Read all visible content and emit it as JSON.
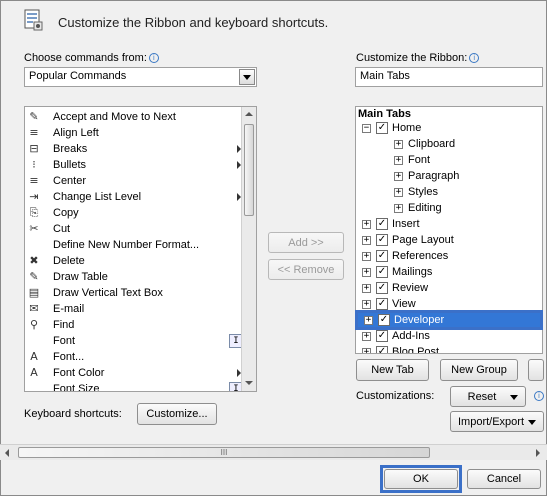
{
  "title": "Customize the Ribbon and keyboard shortcuts.",
  "left": {
    "label": "Choose commands from:",
    "info_glyph": "i",
    "combo_value": "Popular Commands",
    "commands": [
      {
        "label": "Accept and Move to Next",
        "icon": "✎",
        "arrow": false
      },
      {
        "label": "Align Left",
        "icon": "≡",
        "arrow": false
      },
      {
        "label": "Breaks",
        "icon": "⊟",
        "arrow": true
      },
      {
        "label": "Bullets",
        "icon": "⁝",
        "arrow": true
      },
      {
        "label": "Center",
        "icon": "≡",
        "arrow": false
      },
      {
        "label": "Change List Level",
        "icon": "⇥",
        "arrow": true
      },
      {
        "label": "Copy",
        "icon": "⎘",
        "arrow": false
      },
      {
        "label": "Cut",
        "icon": "✂",
        "arrow": false
      },
      {
        "label": "Define New Number Format...",
        "icon": "",
        "arrow": false
      },
      {
        "label": "Delete",
        "icon": "✖",
        "arrow": false
      },
      {
        "label": "Draw Table",
        "icon": "✎",
        "arrow": false
      },
      {
        "label": "Draw Vertical Text Box",
        "icon": "▤",
        "arrow": false
      },
      {
        "label": "E-mail",
        "icon": "✉",
        "arrow": false
      },
      {
        "label": "Find",
        "icon": "⚲",
        "arrow": false
      },
      {
        "label": "Font",
        "icon": "",
        "arrow": false,
        "side": "I"
      },
      {
        "label": "Font...",
        "icon": "A",
        "arrow": false
      },
      {
        "label": "Font Color",
        "icon": "A",
        "arrow": true
      },
      {
        "label": "Font Size",
        "icon": "",
        "arrow": false,
        "side": "I"
      }
    ],
    "keyboard_label": "Keyboard shortcuts:",
    "customize_button": "Customize..."
  },
  "middle": {
    "add_button": "Add >>",
    "remove_button": "<< Remove"
  },
  "right": {
    "label": "Customize the Ribbon:",
    "info_glyph": "i",
    "combo_value": "Main Tabs",
    "tree_header": "Main Tabs",
    "tree": [
      {
        "label": "Home",
        "expander": "−",
        "checked": true,
        "level": 0
      },
      {
        "label": "Clipboard",
        "expander": "+",
        "checked": null,
        "level": 1
      },
      {
        "label": "Font",
        "expander": "+",
        "checked": null,
        "level": 1
      },
      {
        "label": "Paragraph",
        "expander": "+",
        "checked": null,
        "level": 1
      },
      {
        "label": "Styles",
        "expander": "+",
        "checked": null,
        "level": 1
      },
      {
        "label": "Editing",
        "expander": "+",
        "checked": null,
        "level": 1
      },
      {
        "label": "Insert",
        "expander": "+",
        "checked": true,
        "level": 0
      },
      {
        "label": "Page Layout",
        "expander": "+",
        "checked": true,
        "level": 0
      },
      {
        "label": "References",
        "expander": "+",
        "checked": true,
        "level": 0
      },
      {
        "label": "Mailings",
        "expander": "+",
        "checked": true,
        "level": 0
      },
      {
        "label": "Review",
        "expander": "+",
        "checked": true,
        "level": 0
      },
      {
        "label": "View",
        "expander": "+",
        "checked": true,
        "level": 0
      },
      {
        "label": "Developer",
        "expander": "+",
        "checked": true,
        "level": 0,
        "selected": true
      },
      {
        "label": "Add-Ins",
        "expander": "+",
        "checked": true,
        "level": 0
      },
      {
        "label": "Blog Post",
        "expander": "+",
        "checked": true,
        "level": 0
      }
    ],
    "new_tab_button": "New Tab",
    "new_group_button": "New Group",
    "customizations_label": "Customizations:",
    "reset_button": "Reset",
    "import_export_button": "Import/Export",
    "info_glyph2": "i"
  },
  "bottom": {
    "scroll_grip": "III",
    "ok_button": "OK",
    "cancel_button": "Cancel"
  },
  "colors": {
    "selection": "#3377d6",
    "highlight_border": "#3b70c8",
    "info": "#3a78c4"
  }
}
